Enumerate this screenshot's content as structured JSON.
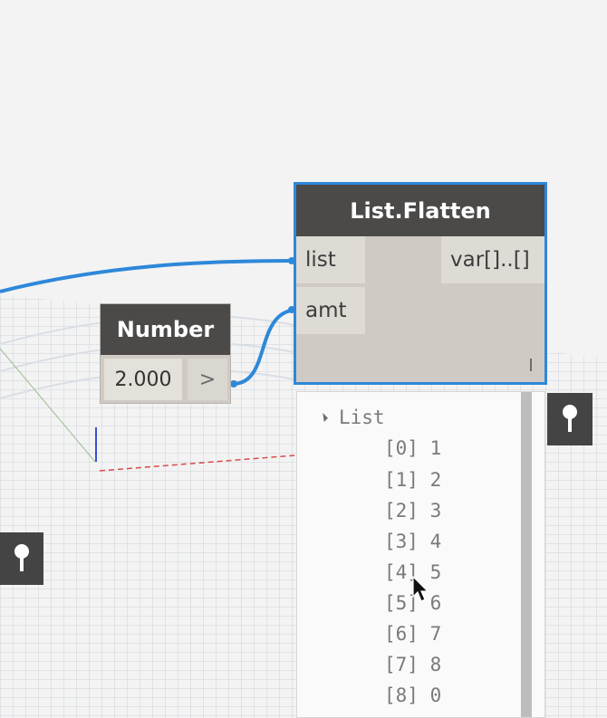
{
  "nodes": {
    "flatten": {
      "title": "List.Flatten",
      "inputs": [
        "list",
        "amt"
      ],
      "output": "var[]..[]"
    },
    "number": {
      "title": "Number",
      "value": "2.000",
      "arrow": ">"
    }
  },
  "preview": {
    "title": "List",
    "items": [
      {
        "index": "[0]",
        "value": "1"
      },
      {
        "index": "[1]",
        "value": "2"
      },
      {
        "index": "[2]",
        "value": "3"
      },
      {
        "index": "[3]",
        "value": "4"
      },
      {
        "index": "[4]",
        "value": "5"
      },
      {
        "index": "[5]",
        "value": "6"
      },
      {
        "index": "[6]",
        "value": "7"
      },
      {
        "index": "[7]",
        "value": "8"
      },
      {
        "index": "[8]",
        "value": "0"
      }
    ]
  },
  "icons": {
    "pin": "pin-icon",
    "collapse": "collapse-triangle-icon",
    "cursor": "mouse-pointer-icon"
  },
  "colors": {
    "wire": "#2e88d9",
    "node_header": "#4b4a49",
    "node_body": "#cfcac3",
    "selection": "#2e88d9"
  }
}
